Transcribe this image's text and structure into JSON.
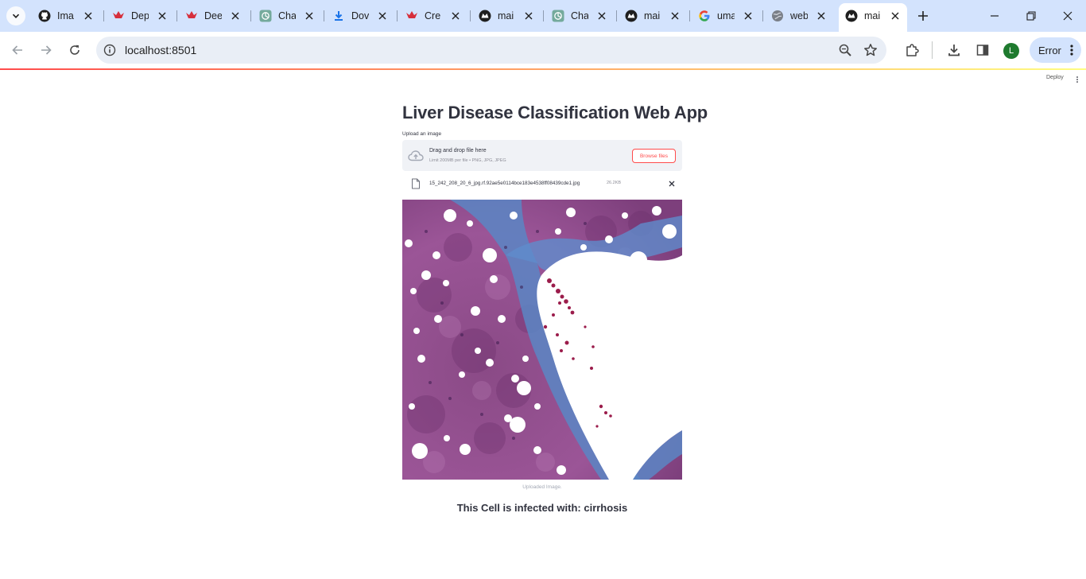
{
  "browser": {
    "tabs": [
      {
        "title": "Ima",
        "icon": "github-icon"
      },
      {
        "title": "Dep",
        "icon": "crown-icon"
      },
      {
        "title": "Dee",
        "icon": "crown-icon"
      },
      {
        "title": "Cha",
        "icon": "openai-icon"
      },
      {
        "title": "Dov",
        "icon": "download-icon"
      },
      {
        "title": "Cre",
        "icon": "crown-icon"
      },
      {
        "title": "mai",
        "icon": "streamlit-icon"
      },
      {
        "title": "Cha",
        "icon": "openai-icon"
      },
      {
        "title": "mai",
        "icon": "streamlit-icon"
      },
      {
        "title": "uma",
        "icon": "google-icon"
      },
      {
        "title": "web",
        "icon": "globe-icon"
      },
      {
        "title": "mai",
        "icon": "streamlit-icon",
        "active": true
      }
    ],
    "url": "localhost:8501",
    "profile_initial": "L",
    "error_label": "Error"
  },
  "streamlit": {
    "deploy_label": "Deploy"
  },
  "app": {
    "title": "Liver Disease Classification Web App",
    "upload_label": "Upload an image",
    "dropzone": {
      "title": "Drag and drop file here",
      "hint": "Limit 200MB per file • PNG, JPG, JPEG",
      "browse_label": "Browse files"
    },
    "file": {
      "name": "15_242_208_20_6_jpg.rf.92ae5e0114bce183e4538ff08439cde1.jpg",
      "size": "26.2KB"
    },
    "image_caption": "Uploaded Image.",
    "result_text": "This Cell is infected with: cirrhosis"
  },
  "colors": {
    "accent": "#ff4b4b",
    "tabstrip": "#d3e3fd",
    "text": "#31333f"
  }
}
